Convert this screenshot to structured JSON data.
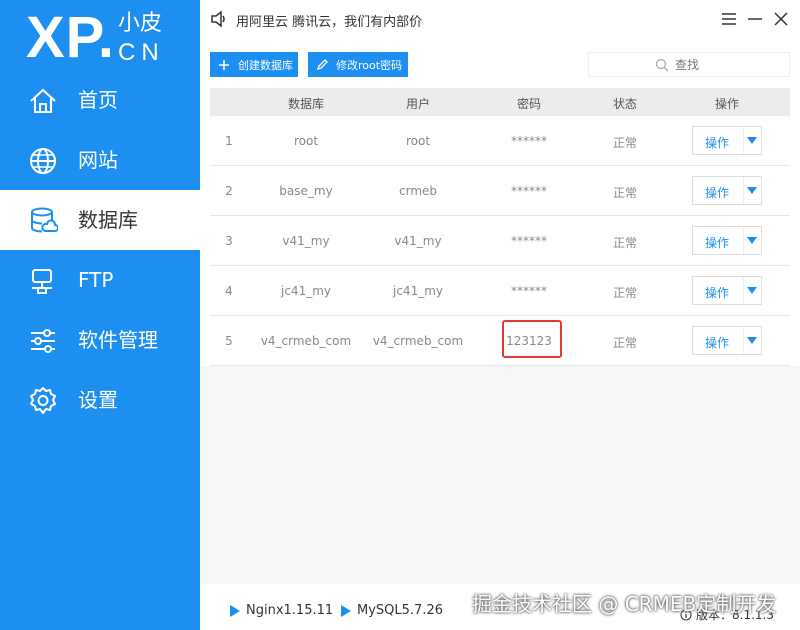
{
  "sidebar": {
    "logo": {
      "main": "XP.",
      "top": "小皮",
      "bottom": "CN"
    },
    "items": [
      {
        "label": "首页",
        "icon": "home-icon"
      },
      {
        "label": "网站",
        "icon": "globe-icon"
      },
      {
        "label": "数据库",
        "icon": "database-icon"
      },
      {
        "label": "FTP",
        "icon": "ftp-icon"
      },
      {
        "label": "软件管理",
        "icon": "sliders-icon"
      },
      {
        "label": "设置",
        "icon": "gear-icon"
      }
    ],
    "active_index": 2
  },
  "titlebar": {
    "notice": "用阿里云 腾讯云，我们有内部价"
  },
  "toolbar": {
    "create_db_label": "创建数据库",
    "change_root_pwd_label": "修改root密码",
    "search_placeholder": "查找"
  },
  "table": {
    "headers": [
      "数据库",
      "用户",
      "密码",
      "状态",
      "操作"
    ],
    "rows": [
      {
        "index": "1",
        "database": "root",
        "user": "root",
        "password": "******",
        "status": "正常",
        "action": "操作"
      },
      {
        "index": "2",
        "database": "base_my",
        "user": "crmeb",
        "password": "******",
        "status": "正常",
        "action": "操作"
      },
      {
        "index": "3",
        "database": "v41_my",
        "user": "v41_my",
        "password": "******",
        "status": "正常",
        "action": "操作"
      },
      {
        "index": "4",
        "database": "jc41_my",
        "user": "jc41_my",
        "password": "******",
        "status": "正常",
        "action": "操作"
      },
      {
        "index": "5",
        "database": "v4_crmeb_com",
        "user": "v4_crmeb_com",
        "password": "123123",
        "status": "正常",
        "action": "操作"
      }
    ]
  },
  "footer": {
    "nginx": "Nginx1.15.11",
    "mysql": "MySQL5.7.26",
    "watermark": "掘金技术社区 @ CRMEB定制开发",
    "version": "版本：8.1.1.3"
  },
  "colors": {
    "primary": "#1d8ff0",
    "highlight": "#e53935"
  }
}
